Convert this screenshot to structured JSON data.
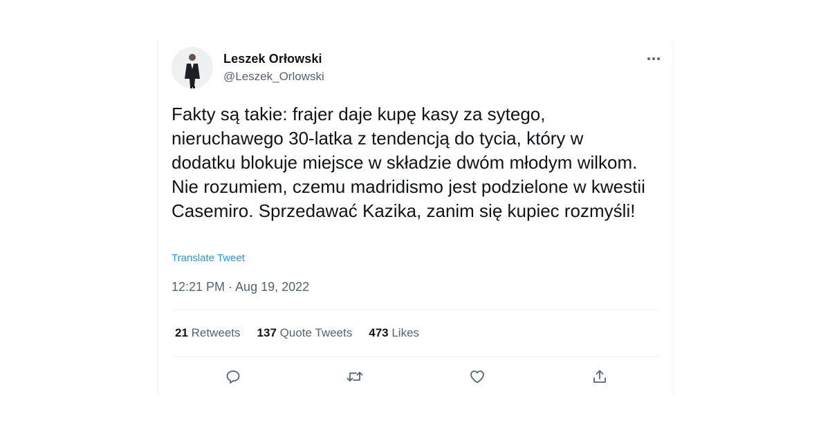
{
  "author": {
    "display_name": "Leszek Orłowski",
    "handle": "@Leszek_Orlowski"
  },
  "tweet": {
    "text": "Fakty są takie: frajer daje kupę kasy za sytego, nieruchawego 30-latka z tendencją do tycia, który w dodatku blokuje miejsce w składzie dwóm młodym wilkom. Nie rozumiem, czemu madridismo jest podzielone w kwestii Casemiro. Sprzedawać Kazika, zanim się kupiec rozmyśli!",
    "translate_label": "Translate Tweet",
    "timestamp": "12:21 PM · Aug 19, 2022"
  },
  "stats": {
    "retweets_count": "21",
    "retweets_label": "Retweets",
    "quotes_count": "137",
    "quotes_label": "Quote Tweets",
    "likes_count": "473",
    "likes_label": "Likes"
  },
  "icons": {
    "more": "more-horizontal-icon",
    "reply": "reply-icon",
    "retweet": "retweet-icon",
    "like": "heart-icon",
    "share": "share-icon"
  },
  "colors": {
    "text_primary": "#0f1419",
    "text_secondary": "#536471",
    "link": "#1d9bf0",
    "divider": "#eff3f4"
  }
}
